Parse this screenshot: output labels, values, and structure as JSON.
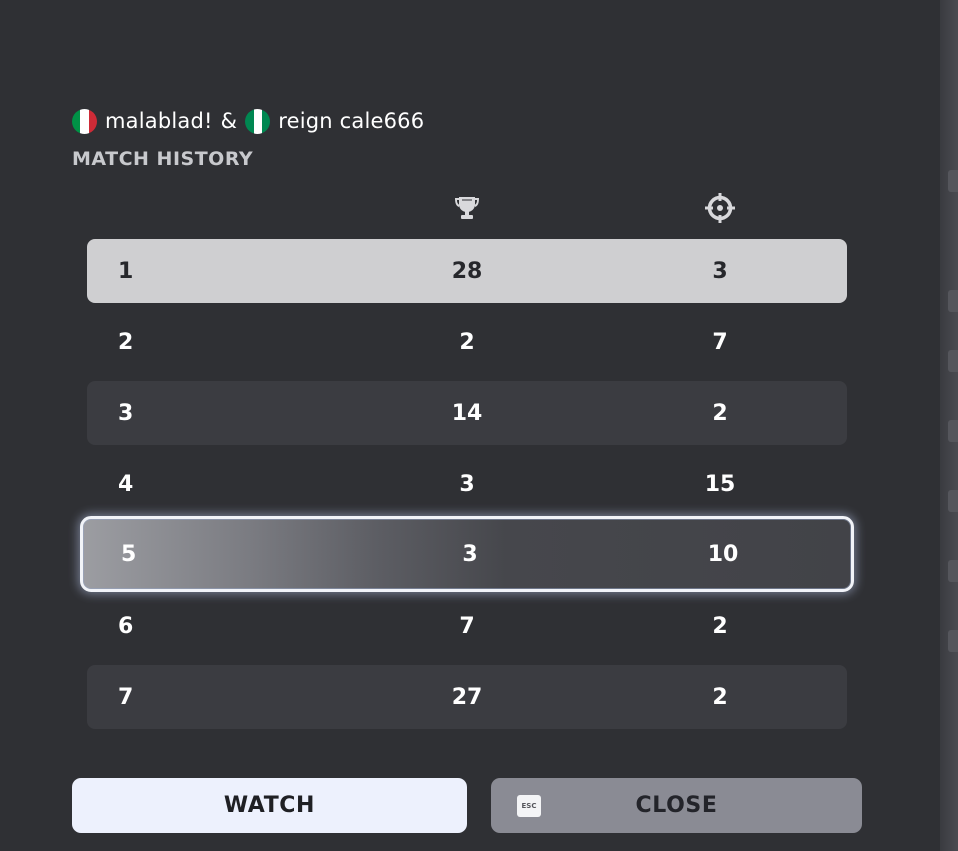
{
  "header": {
    "player1": {
      "name": "malablad!",
      "flag": "italy-flag",
      "colors": [
        "#009246",
        "#ffffff",
        "#ce2b37"
      ]
    },
    "separator": "&",
    "player2": {
      "name": "reign cale666",
      "flag": "nigeria-flag",
      "colors": [
        "#008751",
        "#ffffff",
        "#008751"
      ]
    },
    "title": "MATCH HISTORY"
  },
  "columns": {
    "trophy_icon": "trophy-icon",
    "kills_icon": "crosshair-icon"
  },
  "rows": [
    {
      "match": "1",
      "placement": "28",
      "kills": "3"
    },
    {
      "match": "2",
      "placement": "2",
      "kills": "7"
    },
    {
      "match": "3",
      "placement": "14",
      "kills": "2"
    },
    {
      "match": "4",
      "placement": "3",
      "kills": "15"
    },
    {
      "match": "5",
      "placement": "3",
      "kills": "10"
    },
    {
      "match": "6",
      "placement": "7",
      "kills": "2"
    },
    {
      "match": "7",
      "placement": "27",
      "kills": "2"
    }
  ],
  "selected_row": 5,
  "buttons": {
    "watch_label": "WATCH",
    "close_label": "CLOSE",
    "close_key_hint": "ESC"
  },
  "theme": {
    "background": "#2f3034",
    "row_stripe": "#3b3c41",
    "first_row": "#cfcfd1",
    "watch_button": "#edf1fd",
    "close_button": "#8a8b94"
  }
}
